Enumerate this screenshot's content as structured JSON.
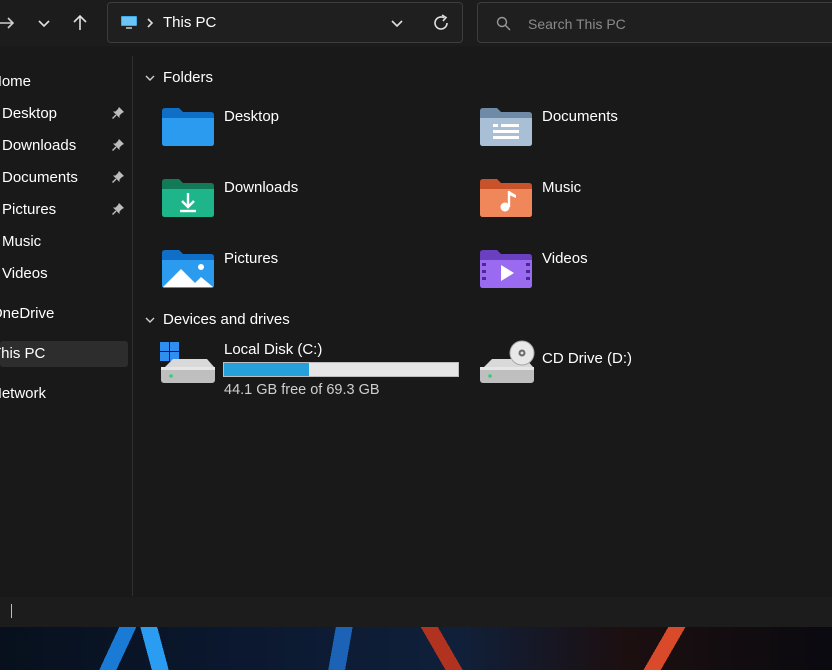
{
  "address": {
    "location": "This PC"
  },
  "search": {
    "placeholder": "Search This PC"
  },
  "sidebar": {
    "items": [
      {
        "label": "Home"
      },
      {
        "label": "Desktop"
      },
      {
        "label": "Downloads"
      },
      {
        "label": "Documents"
      },
      {
        "label": "Pictures"
      },
      {
        "label": "Music"
      },
      {
        "label": "Videos"
      },
      {
        "label": "OneDrive"
      },
      {
        "label": "This PC"
      },
      {
        "label": "Network"
      }
    ]
  },
  "folders": {
    "header": "Folders",
    "items": [
      {
        "label": "Desktop"
      },
      {
        "label": "Documents"
      },
      {
        "label": "Downloads"
      },
      {
        "label": "Music"
      },
      {
        "label": "Pictures"
      },
      {
        "label": "Videos"
      }
    ]
  },
  "devices": {
    "header": "Devices and drives",
    "local_disk": {
      "name": "Local Disk (C:)",
      "free_text": "44.1 GB free of 69.3 GB",
      "used_fraction": 0.364
    },
    "cd_drive": {
      "name": "CD Drive (D:)"
    }
  },
  "colors": {
    "accent": "#26a0da",
    "background": "#191919"
  }
}
